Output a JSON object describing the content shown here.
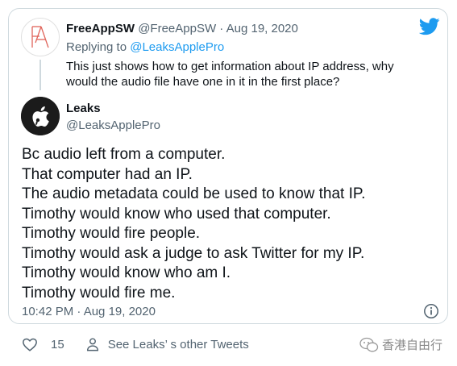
{
  "reply_tweet": {
    "name": "FreeAppSW",
    "handle": "@FreeAppSW",
    "separator": "·",
    "date": "Aug 19, 2020",
    "replying_prefix": "Replying to",
    "replying_handle": "@LeaksApplePro",
    "text_lines": [
      "This just shows how to get information about IP address, why",
      "would the audio file have one in it in the first place?"
    ]
  },
  "main_tweet": {
    "name": "Leaks",
    "handle": "@LeaksApplePro",
    "body_lines": [
      "Bc audio left from a computer.",
      "That computer had an IP.",
      "The audio metadata could be used to know that IP.",
      "Timothy would know who used that computer.",
      "Timothy would fire people.",
      "Timothy would ask a judge to ask Twitter for my IP.",
      "Timothy would know who am I.",
      "Timothy would fire me."
    ],
    "timestamp": "10:42 PM · Aug 19, 2020"
  },
  "footer": {
    "likes": "15",
    "see_other": "See Leaks’ s other Tweets"
  },
  "watermark": {
    "text": "香港自由行"
  },
  "colors": {
    "accent": "#1d9bf0",
    "muted": "#536471",
    "logo_red": "#e0645a"
  }
}
